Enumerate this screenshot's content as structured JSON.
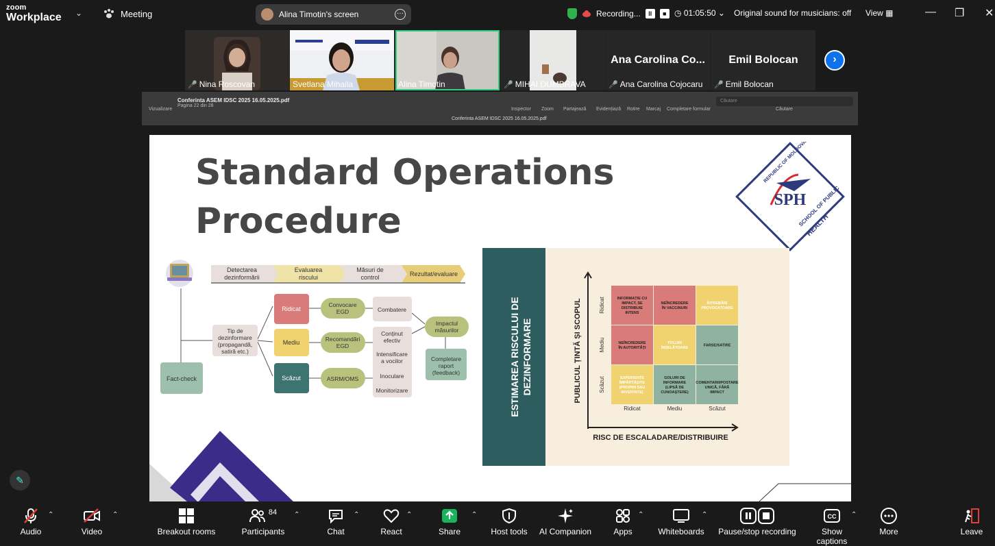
{
  "topbar": {
    "logo_line1": "zoom",
    "logo_line2": "Workplace",
    "meeting_label": "Meeting",
    "screen_label": "Alina Timotin's screen",
    "recording_label": "Recording...",
    "timer": "01:05:50",
    "sound_label": "Original sound for musicians: off",
    "view_label": "View"
  },
  "gallery": {
    "participants": [
      {
        "name": "Nina Roscovan",
        "muted": true
      },
      {
        "name": "Svetlana Mihaila",
        "muted": false
      },
      {
        "name": "Alina Timotin",
        "muted": false
      },
      {
        "name": "MIHAI DUMBRAVA",
        "muted": true
      },
      {
        "display": "Ana Carolina Co...",
        "name": "Ana Carolina Cojocaru",
        "muted": true
      },
      {
        "display": "Emil Bolocan",
        "name": "Emil Bolocan",
        "muted": true
      }
    ]
  },
  "pdf_viewer": {
    "file_title": "Conferinta ASEM IDSC 2025 16.05.2025.pdf",
    "page_info": "Pagina 22 din 28",
    "center_title": "Conferinta ASEM IDSC 2025 16.05.2025.pdf",
    "sidebar_label": "Vizualizare",
    "tools": [
      "Inspector",
      "Zoom",
      "Partajează",
      "Evidențiază",
      "Rotire",
      "Marcaj",
      "Completare formular"
    ],
    "search_placeholder": "Căutare",
    "search_label": "Căutare"
  },
  "slide": {
    "title_line1": "Standard Operations",
    "title_line2": "Procedure",
    "logo_text": "SPH",
    "logo_ring": "REPUBLIC OF MOLDOVA · SCHOOL OF PUBLIC HEALTH",
    "steps": [
      "Detectarea dezinformării",
      "Evaluarea riscului",
      "Măsuri de control",
      "Rezultat/evaluare"
    ],
    "flow": {
      "fact_check": "Fact-check",
      "type": "Tip de dezinformare (propagandă, satiră etc.)",
      "levels": [
        "Ridicat",
        "Mediu",
        "Scăzut"
      ],
      "actions": [
        "Convocare EGD",
        "Recomandări EGD",
        "ASRM/OMS"
      ],
      "measures": [
        "Combatere",
        "Conținut efectiv",
        "Intensificare a vocilor",
        "Inoculare",
        "Monitorizare"
      ],
      "impact": "Impactul măsurilor",
      "report": "Completare raport (feedback)"
    },
    "matrix": {
      "side_label": "ESTIMAREA RISCULUI DE DEZINFORMARE",
      "y_axis": "PUBLICUL ȚINTĂ ȘI SCOPUL",
      "x_axis": "RISC DE ESCALADARE/DISTRIBUIRE",
      "row_labels": [
        "Ridicat",
        "Mediu",
        "Scăzut"
      ],
      "col_labels": [
        "Ridicat",
        "Mediu",
        "Scăzut"
      ],
      "cells": [
        [
          "INFORMAȚIE CU IMPACT, SE DISTRIBUIE INTENS",
          "NEÎNCREDERE ÎN VACCINURI",
          "ÎNTREBĂRI PROVOCATOARE"
        ],
        [
          "NEÎNCREDERE ÎN AUTORITĂȚI",
          "TITLURI ÎNȘELĂTOARE",
          "FARSE/SATIRE"
        ],
        [
          "EXPERIENȚE ÎMPĂRTĂȘITE (PROPRII SAU INVENTATE)",
          "GOLURI DE INFORMARE (LIPSĂ DE CUNOAȘTERE)",
          "COMENTARII/POSTARE UNICĂ, FĂRĂ IMPACT"
        ]
      ]
    }
  },
  "controls": {
    "audio": "Audio",
    "video": "Video",
    "breakout": "Breakout rooms",
    "participants": "Participants",
    "participants_count": "84",
    "chat": "Chat",
    "react": "React",
    "share": "Share",
    "host_tools": "Host tools",
    "ai": "AI Companion",
    "apps": "Apps",
    "whiteboards": "Whiteboards",
    "pause_rec": "Pause/stop recording",
    "captions": "Show captions",
    "more": "More",
    "leave": "Leave"
  },
  "colors": {
    "accent_blue": "#0e72ed",
    "share_green": "#19b35b",
    "active_outline": "#2fcf80",
    "matrix_teal": "#2d5d5e",
    "red_cell": "#d97b78",
    "yellow_cell": "#f0d36f",
    "green_cell": "#8fb3a0"
  }
}
